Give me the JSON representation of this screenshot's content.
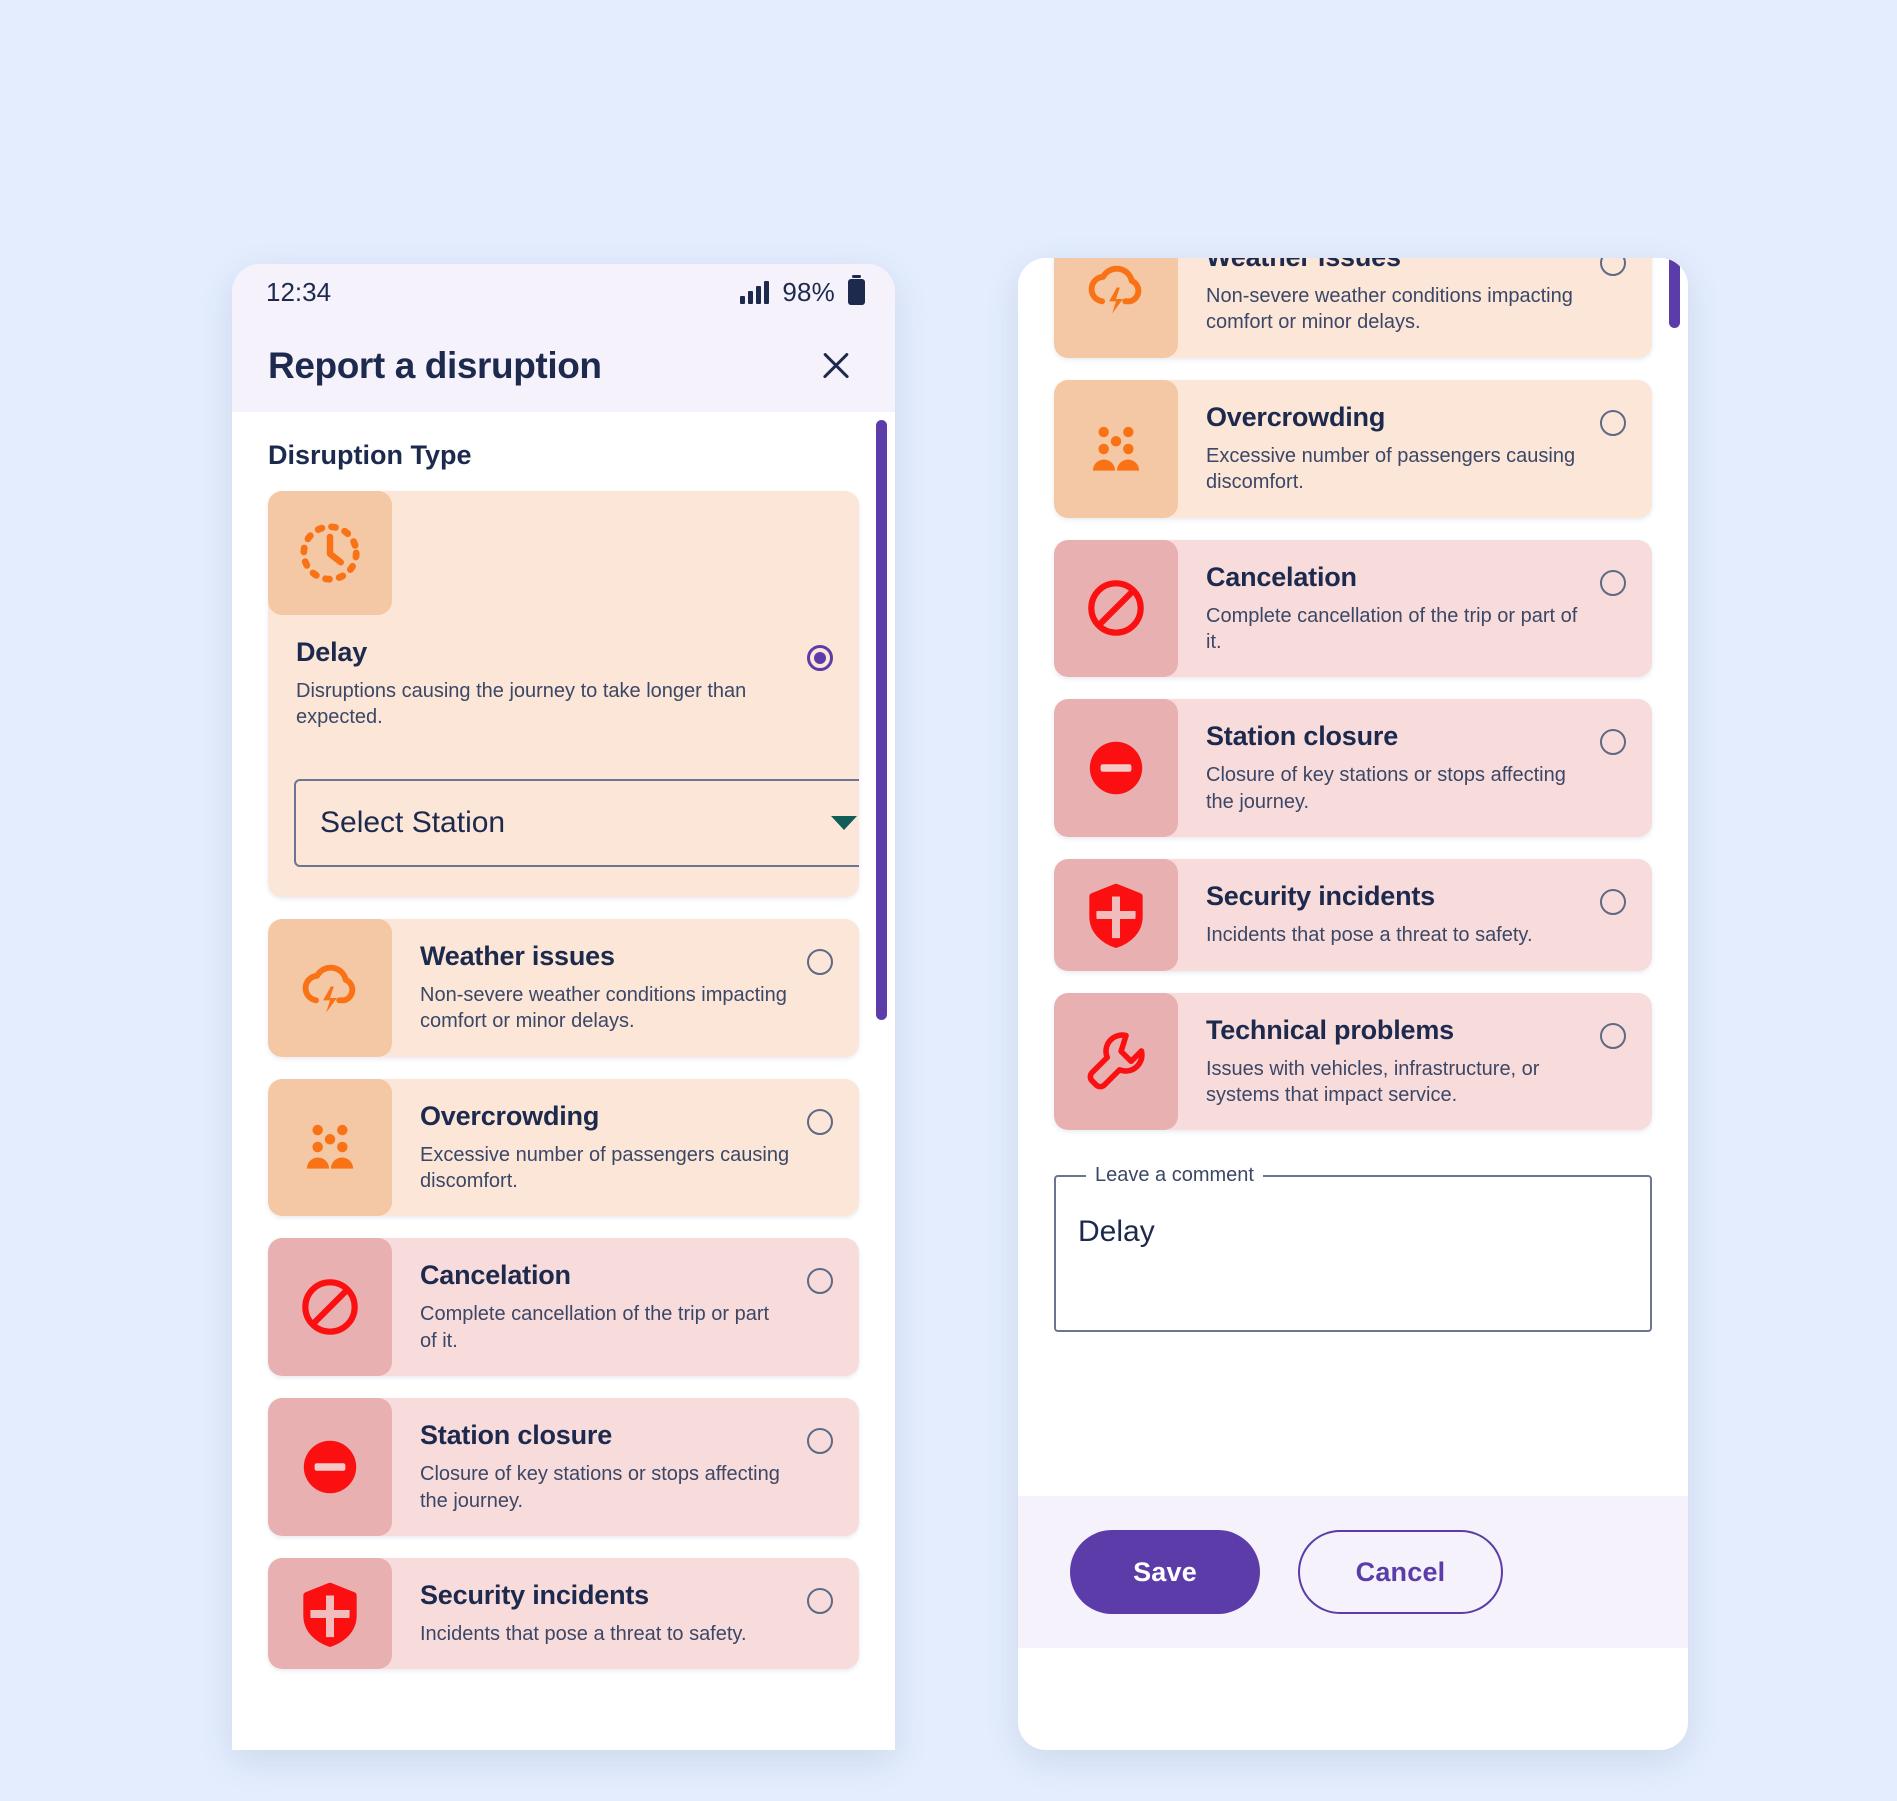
{
  "theme": {
    "page_bg": "#e3edfd",
    "accent_purple": "#5b3ca8",
    "orange": "#f97316",
    "red": "#fb0f11",
    "text_dark": "#1d2a4d",
    "tile_orange": "#f4c8a4",
    "tile_red": "#e8b0b0",
    "card_orange": "#fbe6d8",
    "card_red": "#f8dcdc"
  },
  "status_bar": {
    "time": "12:34",
    "battery_percent": "98%",
    "signal_icon": "signal-bars-icon",
    "battery_icon": "battery-icon"
  },
  "app_bar": {
    "title": "Report a disruption",
    "close_icon": "close-icon"
  },
  "left_screen": {
    "section_label": "Disruption Type",
    "station_select": {
      "value": "Select Station",
      "caret_icon": "chevron-down-icon"
    }
  },
  "options": [
    {
      "id": "delay",
      "title": "Delay",
      "description": "Disruptions causing the journey to take longer than expected.",
      "icon": "clock-dashed-icon",
      "tone": "orange",
      "selected": true
    },
    {
      "id": "weather-issues",
      "title": "Weather issues",
      "description": "Non-severe weather conditions impacting comfort or minor delays.",
      "icon": "cloud-lightning-icon",
      "tone": "orange",
      "selected": false
    },
    {
      "id": "overcrowding",
      "title": "Overcrowding",
      "description": "Excessive number of passengers causing discomfort.",
      "icon": "crowd-people-icon",
      "tone": "orange",
      "selected": false
    },
    {
      "id": "cancelation",
      "title": "Cancelation",
      "description": "Complete cancellation of the trip or part of it.",
      "icon": "prohibited-circle-icon",
      "tone": "red",
      "selected": false
    },
    {
      "id": "station-closure",
      "title": "Station closure",
      "description": "Closure of key stations or stops affecting the journey.",
      "icon": "minus-circle-icon",
      "tone": "red",
      "selected": false
    },
    {
      "id": "security-incidents",
      "title": "Security incidents",
      "description": "Incidents that pose a threat to safety.",
      "icon": "shield-icon",
      "tone": "red",
      "selected": false
    },
    {
      "id": "technical-problems",
      "title": "Technical problems",
      "description": "Issues with vehicles, infrastructure, or systems that impact service.",
      "icon": "wrench-icon",
      "tone": "red",
      "selected": false
    }
  ],
  "right_screen": {
    "comment": {
      "legend": "Leave a comment",
      "value": "Delay"
    },
    "actions": {
      "save_label": "Save",
      "cancel_label": "Cancel"
    }
  }
}
